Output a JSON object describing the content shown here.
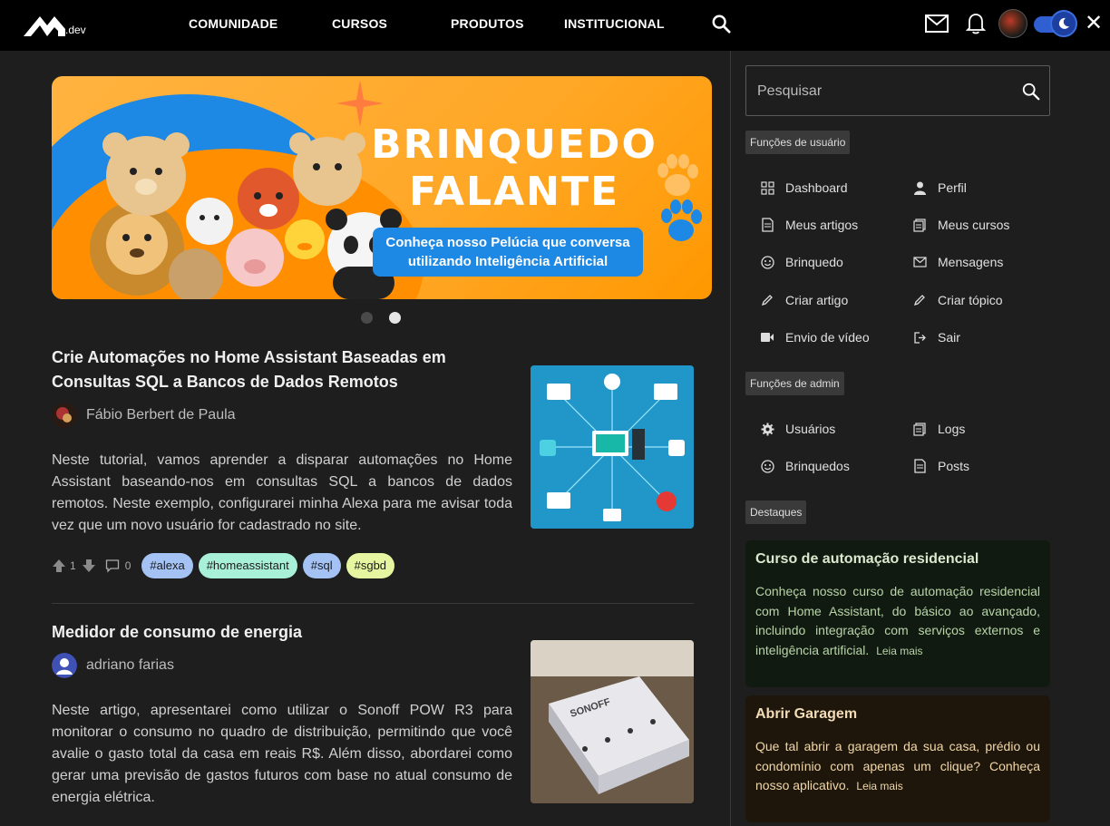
{
  "navbar": {
    "logo_suffix": ".dev",
    "links": [
      "COMUNIDADE",
      "CURSOS",
      "PRODUTOS",
      "INSTITUCIONAL"
    ],
    "close_glyph": "✕"
  },
  "banner": {
    "title_line1": "BRINQUEDO",
    "title_line2": "FALANTE",
    "subtitle": "Conheça nosso Pelúcia que conversa utilizando Inteligência Artificial",
    "slide_count": 2,
    "active_slide": 2
  },
  "articles": [
    {
      "title": "Crie Automações no Home Assistant Baseadas em Consultas SQL a Bancos de Dados Remotos",
      "author": "Fábio Berbert de Paula",
      "body": "Neste tutorial, vamos aprender a disparar automações no Home Assistant baseando-nos em consultas SQL a bancos de dados remotos. Neste exemplo, configurarei minha Alexa para me avisar toda vez que um novo usuário for cadastrado no site.",
      "upvotes": "1",
      "comments": "0",
      "tags": [
        {
          "label": "#alexa",
          "color": "#a4c2f4"
        },
        {
          "label": "#homeassistant",
          "color": "#a8f0d8"
        },
        {
          "label": "#sql",
          "color": "#a4c2f4"
        },
        {
          "label": "#sgbd",
          "color": "#e6f5a0"
        }
      ]
    },
    {
      "title": "Medidor de consumo de energia",
      "author": "adriano farias",
      "body": "Neste artigo, apresentarei como utilizar o Sonoff POW R3 para monitorar o consumo no quadro de distribuição, permitindo que você avalie o gasto total da casa em reais R$. Além disso, abordarei como gerar uma previsão de gastos futuros com base no atual consumo de energia elétrica."
    }
  ],
  "sidebar": {
    "search_placeholder": "Pesquisar",
    "user_section": "Funções de usuário",
    "user_items": [
      {
        "label": "Dashboard",
        "icon": "grid-icon"
      },
      {
        "label": "Perfil",
        "icon": "person-icon"
      },
      {
        "label": "Meus artigos",
        "icon": "article-icon"
      },
      {
        "label": "Meus cursos",
        "icon": "course-icon"
      },
      {
        "label": "Brinquedo",
        "icon": "smile-icon"
      },
      {
        "label": "Mensagens",
        "icon": "mail-icon"
      },
      {
        "label": "Criar artigo",
        "icon": "pencil-icon"
      },
      {
        "label": "Criar tópico",
        "icon": "pencil-icon"
      },
      {
        "label": "Envio de vídeo",
        "icon": "video-icon"
      },
      {
        "label": "Sair",
        "icon": "logout-icon"
      }
    ],
    "admin_section": "Funções de admin",
    "admin_items": [
      {
        "label": "Usuários",
        "icon": "gear-icon"
      },
      {
        "label": "Logs",
        "icon": "log-icon"
      },
      {
        "label": "Brinquedos",
        "icon": "smile-icon"
      },
      {
        "label": "Posts",
        "icon": "posts-icon"
      }
    ],
    "highlights_section": "Destaques",
    "highlights": [
      {
        "title": "Curso de automação residencial",
        "text": "Conheça nosso curso de automação residencial com Home Assistant, do básico ao avançado, incluindo integração com serviços externos e inteligência artificial.",
        "more": "Leia mais",
        "bg": "#101a10",
        "title_color": "#dbe9cf",
        "text_color": "#b8d4a8"
      },
      {
        "title": "Abrir Garagem",
        "text": "Que tal abrir a garagem da sua casa, prédio ou condomínio com apenas um clique? Conheça nosso aplicativo.",
        "more": "Leia mais",
        "bg": "#1f160b",
        "title_color": "#f3ddb8",
        "text_color": "#f0d7a8"
      }
    ]
  }
}
